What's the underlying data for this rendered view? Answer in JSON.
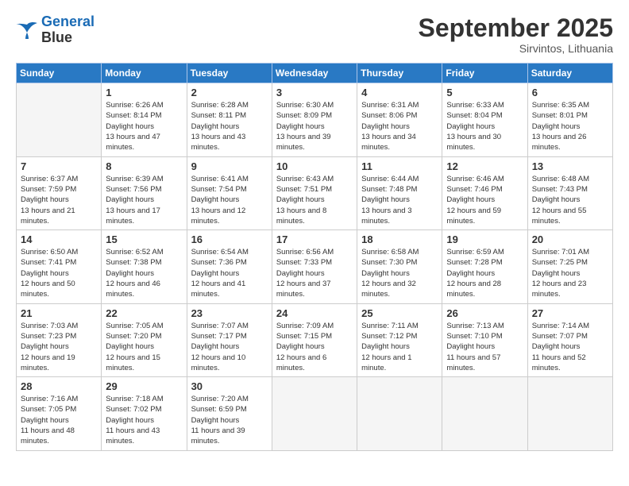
{
  "header": {
    "logo_line1": "General",
    "logo_line2": "Blue",
    "month": "September 2025",
    "location": "Sirvintos, Lithuania"
  },
  "weekdays": [
    "Sunday",
    "Monday",
    "Tuesday",
    "Wednesday",
    "Thursday",
    "Friday",
    "Saturday"
  ],
  "weeks": [
    [
      {
        "day": "",
        "sunrise": "",
        "sunset": "",
        "daylight": ""
      },
      {
        "day": "1",
        "sunrise": "6:26 AM",
        "sunset": "8:14 PM",
        "daylight": "13 hours and 47 minutes."
      },
      {
        "day": "2",
        "sunrise": "6:28 AM",
        "sunset": "8:11 PM",
        "daylight": "13 hours and 43 minutes."
      },
      {
        "day": "3",
        "sunrise": "6:30 AM",
        "sunset": "8:09 PM",
        "daylight": "13 hours and 39 minutes."
      },
      {
        "day": "4",
        "sunrise": "6:31 AM",
        "sunset": "8:06 PM",
        "daylight": "13 hours and 34 minutes."
      },
      {
        "day": "5",
        "sunrise": "6:33 AM",
        "sunset": "8:04 PM",
        "daylight": "13 hours and 30 minutes."
      },
      {
        "day": "6",
        "sunrise": "6:35 AM",
        "sunset": "8:01 PM",
        "daylight": "13 hours and 26 minutes."
      }
    ],
    [
      {
        "day": "7",
        "sunrise": "6:37 AM",
        "sunset": "7:59 PM",
        "daylight": "13 hours and 21 minutes."
      },
      {
        "day": "8",
        "sunrise": "6:39 AM",
        "sunset": "7:56 PM",
        "daylight": "13 hours and 17 minutes."
      },
      {
        "day": "9",
        "sunrise": "6:41 AM",
        "sunset": "7:54 PM",
        "daylight": "13 hours and 12 minutes."
      },
      {
        "day": "10",
        "sunrise": "6:43 AM",
        "sunset": "7:51 PM",
        "daylight": "13 hours and 8 minutes."
      },
      {
        "day": "11",
        "sunrise": "6:44 AM",
        "sunset": "7:48 PM",
        "daylight": "13 hours and 3 minutes."
      },
      {
        "day": "12",
        "sunrise": "6:46 AM",
        "sunset": "7:46 PM",
        "daylight": "12 hours and 59 minutes."
      },
      {
        "day": "13",
        "sunrise": "6:48 AM",
        "sunset": "7:43 PM",
        "daylight": "12 hours and 55 minutes."
      }
    ],
    [
      {
        "day": "14",
        "sunrise": "6:50 AM",
        "sunset": "7:41 PM",
        "daylight": "12 hours and 50 minutes."
      },
      {
        "day": "15",
        "sunrise": "6:52 AM",
        "sunset": "7:38 PM",
        "daylight": "12 hours and 46 minutes."
      },
      {
        "day": "16",
        "sunrise": "6:54 AM",
        "sunset": "7:36 PM",
        "daylight": "12 hours and 41 minutes."
      },
      {
        "day": "17",
        "sunrise": "6:56 AM",
        "sunset": "7:33 PM",
        "daylight": "12 hours and 37 minutes."
      },
      {
        "day": "18",
        "sunrise": "6:58 AM",
        "sunset": "7:30 PM",
        "daylight": "12 hours and 32 minutes."
      },
      {
        "day": "19",
        "sunrise": "6:59 AM",
        "sunset": "7:28 PM",
        "daylight": "12 hours and 28 minutes."
      },
      {
        "day": "20",
        "sunrise": "7:01 AM",
        "sunset": "7:25 PM",
        "daylight": "12 hours and 23 minutes."
      }
    ],
    [
      {
        "day": "21",
        "sunrise": "7:03 AM",
        "sunset": "7:23 PM",
        "daylight": "12 hours and 19 minutes."
      },
      {
        "day": "22",
        "sunrise": "7:05 AM",
        "sunset": "7:20 PM",
        "daylight": "12 hours and 15 minutes."
      },
      {
        "day": "23",
        "sunrise": "7:07 AM",
        "sunset": "7:17 PM",
        "daylight": "12 hours and 10 minutes."
      },
      {
        "day": "24",
        "sunrise": "7:09 AM",
        "sunset": "7:15 PM",
        "daylight": "12 hours and 6 minutes."
      },
      {
        "day": "25",
        "sunrise": "7:11 AM",
        "sunset": "7:12 PM",
        "daylight": "12 hours and 1 minute."
      },
      {
        "day": "26",
        "sunrise": "7:13 AM",
        "sunset": "7:10 PM",
        "daylight": "11 hours and 57 minutes."
      },
      {
        "day": "27",
        "sunrise": "7:14 AM",
        "sunset": "7:07 PM",
        "daylight": "11 hours and 52 minutes."
      }
    ],
    [
      {
        "day": "28",
        "sunrise": "7:16 AM",
        "sunset": "7:05 PM",
        "daylight": "11 hours and 48 minutes."
      },
      {
        "day": "29",
        "sunrise": "7:18 AM",
        "sunset": "7:02 PM",
        "daylight": "11 hours and 43 minutes."
      },
      {
        "day": "30",
        "sunrise": "7:20 AM",
        "sunset": "6:59 PM",
        "daylight": "11 hours and 39 minutes."
      },
      {
        "day": "",
        "sunrise": "",
        "sunset": "",
        "daylight": ""
      },
      {
        "day": "",
        "sunrise": "",
        "sunset": "",
        "daylight": ""
      },
      {
        "day": "",
        "sunrise": "",
        "sunset": "",
        "daylight": ""
      },
      {
        "day": "",
        "sunrise": "",
        "sunset": "",
        "daylight": ""
      }
    ]
  ],
  "labels": {
    "sunrise": "Sunrise:",
    "sunset": "Sunset:",
    "daylight": "Daylight hours"
  }
}
